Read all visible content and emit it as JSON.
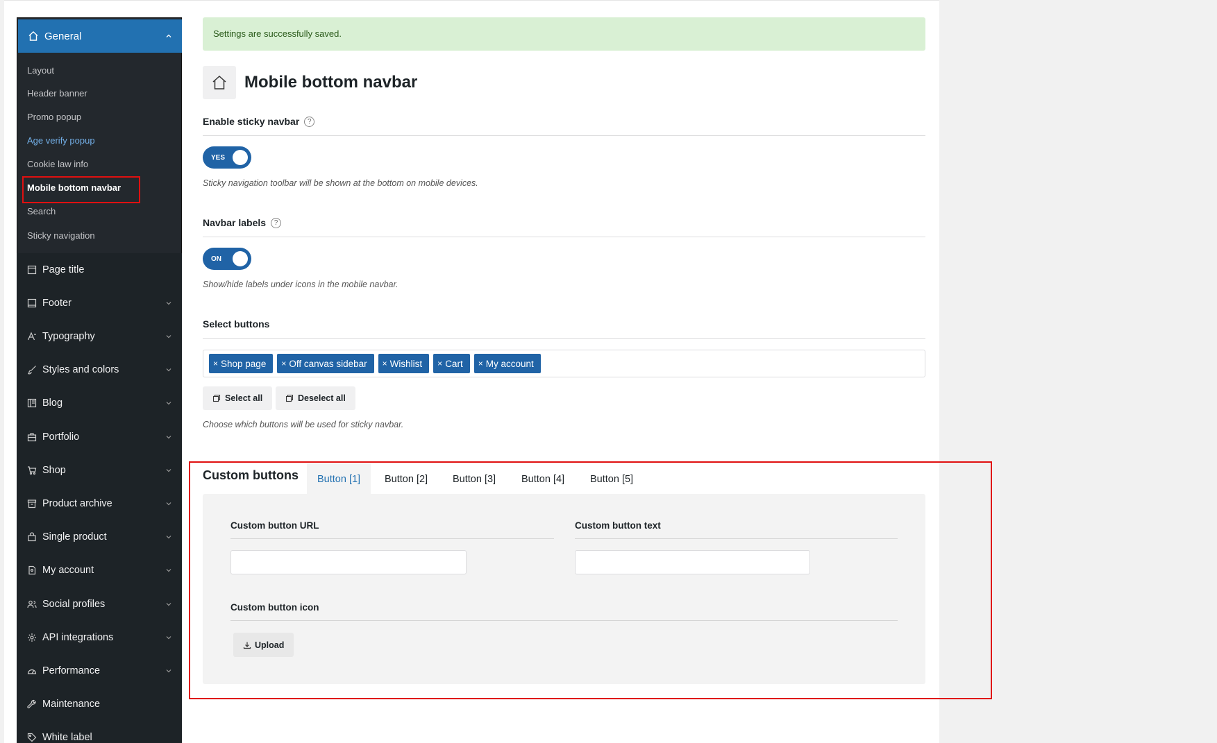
{
  "sidebar": {
    "general": {
      "label": "General",
      "icon": "home-icon"
    },
    "sub_items": [
      {
        "label": "Layout"
      },
      {
        "label": "Header banner"
      },
      {
        "label": "Promo popup"
      },
      {
        "label": "Age verify popup"
      },
      {
        "label": "Cookie law info"
      },
      {
        "label": "Mobile bottom navbar"
      },
      {
        "label": "Search"
      },
      {
        "label": "Sticky navigation"
      }
    ],
    "items": [
      {
        "label": "Page title",
        "icon": "page-title-icon"
      },
      {
        "label": "Footer",
        "icon": "footer-icon"
      },
      {
        "label": "Typography",
        "icon": "typography-icon"
      },
      {
        "label": "Styles and colors",
        "icon": "brush-icon"
      },
      {
        "label": "Blog",
        "icon": "blog-icon"
      },
      {
        "label": "Portfolio",
        "icon": "briefcase-icon"
      },
      {
        "label": "Shop",
        "icon": "cart-icon"
      },
      {
        "label": "Product archive",
        "icon": "archive-icon"
      },
      {
        "label": "Single product",
        "icon": "bag-icon"
      },
      {
        "label": "My account",
        "icon": "account-icon"
      },
      {
        "label": "Social profiles",
        "icon": "people-icon"
      },
      {
        "label": "API integrations",
        "icon": "gear-icon"
      },
      {
        "label": "Performance",
        "icon": "gauge-icon"
      },
      {
        "label": "Maintenance",
        "icon": "wrench-icon"
      },
      {
        "label": "White label",
        "icon": "tag-icon"
      }
    ]
  },
  "notice": "Settings are successfully saved.",
  "page_title": "Mobile bottom navbar",
  "sticky": {
    "label": "Enable sticky navbar",
    "toggle": "YES",
    "description": "Sticky navigation toolbar will be shown at the bottom on mobile devices."
  },
  "labels": {
    "label": "Navbar labels",
    "toggle": "ON",
    "description": "Show/hide labels under icons in the mobile navbar."
  },
  "select_buttons": {
    "label": "Select buttons",
    "tags": [
      "Shop page",
      "Off canvas sidebar",
      "Wishlist",
      "Cart",
      "My account"
    ],
    "remove_glyph": "×",
    "select_all": "Select all",
    "deselect_all": "Deselect all",
    "description": "Choose which buttons will be used for sticky navbar."
  },
  "custom_buttons": {
    "title": "Custom buttons",
    "tabs": [
      "Button [1]",
      "Button [2]",
      "Button [3]",
      "Button [4]",
      "Button [5]"
    ],
    "active_tab": "Button [1]",
    "url_label": "Custom button URL",
    "url_value": "",
    "text_label": "Custom button text",
    "text_value": "",
    "icon_label": "Custom button icon",
    "upload": "Upload"
  },
  "colors": {
    "accent": "#2271b1",
    "sidebar_bg": "#1d2327",
    "notice_bg": "#d9f0d4",
    "toggle_bg": "#2063a6",
    "highlight": "#e01010"
  }
}
